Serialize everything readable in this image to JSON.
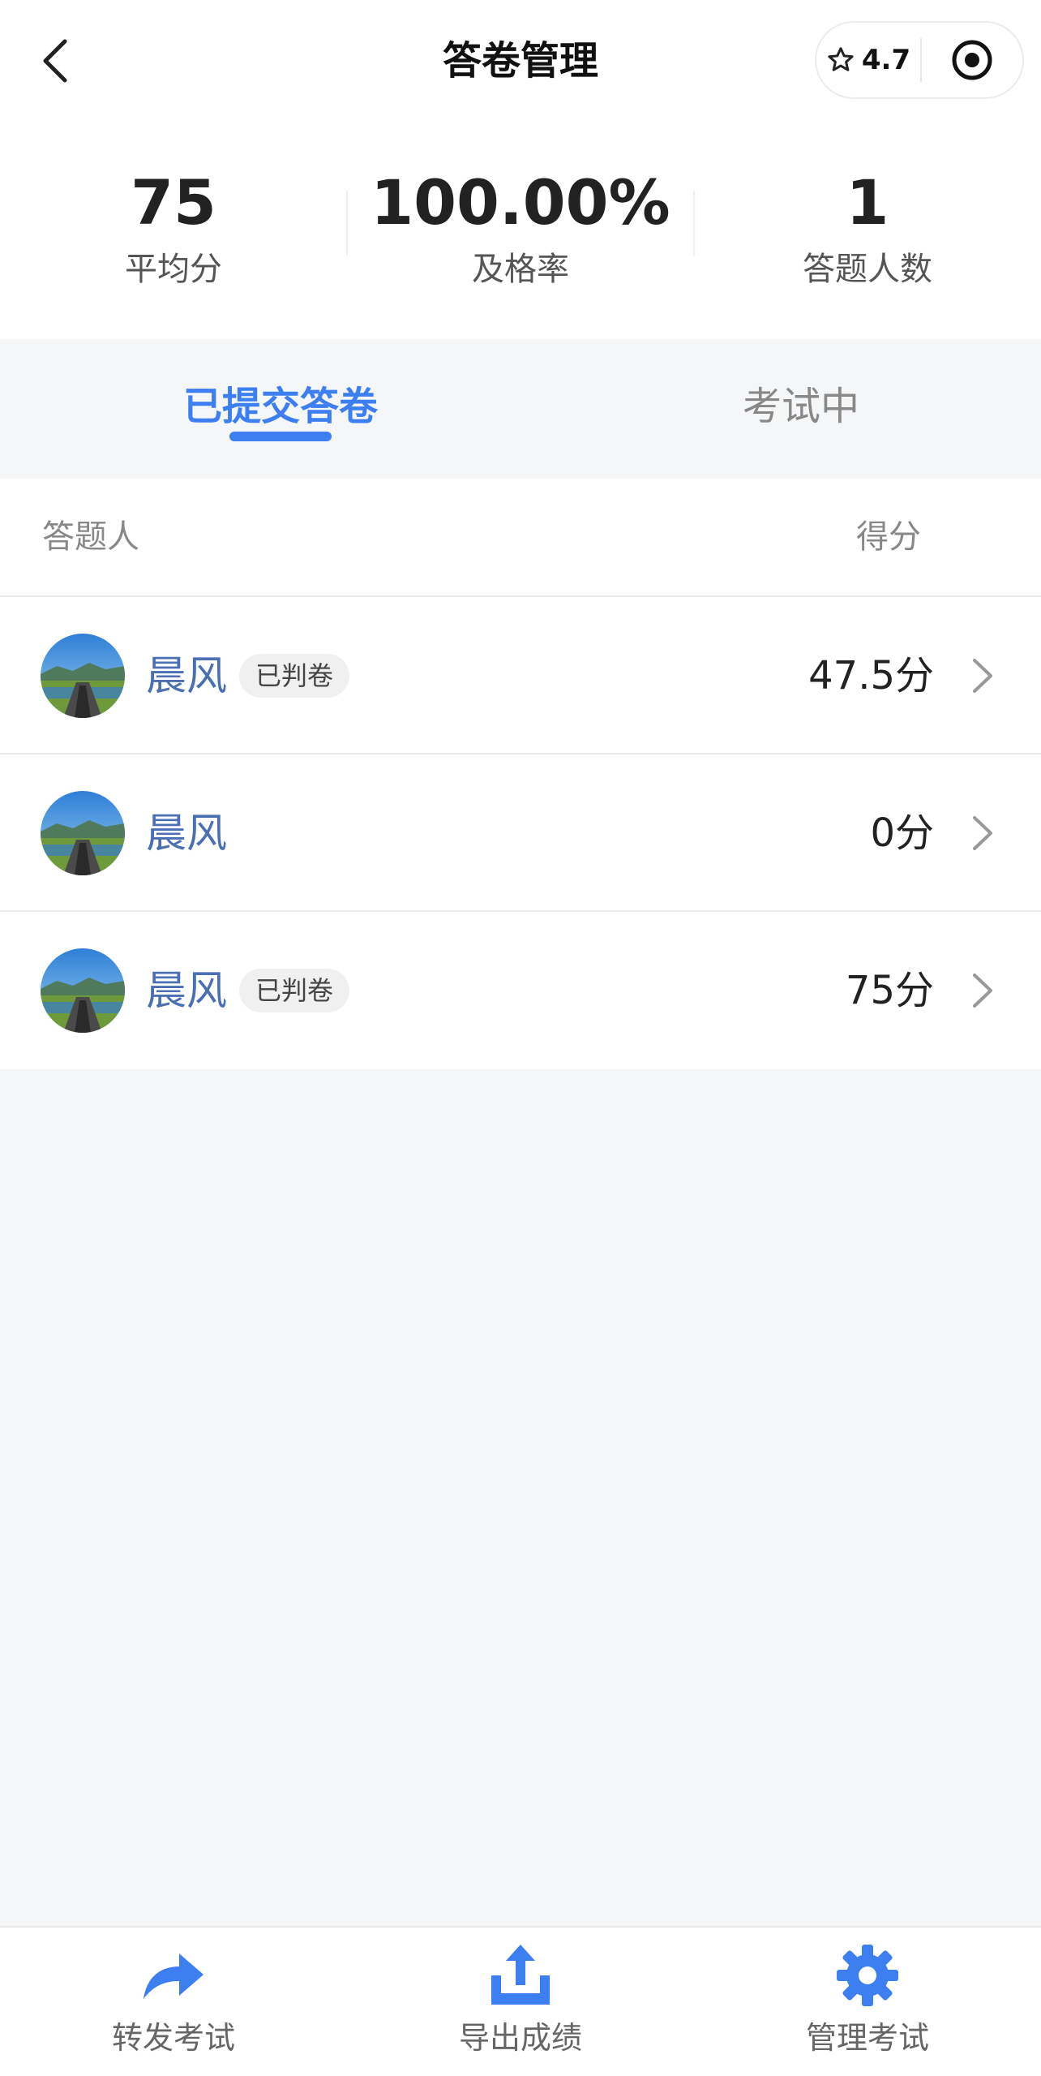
{
  "header": {
    "title": "答卷管理",
    "rating": "4.7"
  },
  "stats": [
    {
      "value": "75",
      "label": "平均分"
    },
    {
      "value": "100.00%",
      "label": "及格率"
    },
    {
      "value": "1",
      "label": "答题人数"
    }
  ],
  "tabs": [
    {
      "label": "已提交答卷",
      "active": true
    },
    {
      "label": "考试中",
      "active": false
    }
  ],
  "table": {
    "col_left": "答题人",
    "col_right": "得分",
    "rows": [
      {
        "name": "晨风",
        "badge": "已判卷",
        "score": "47.5分"
      },
      {
        "name": "晨风",
        "badge": "",
        "score": "0分"
      },
      {
        "name": "晨风",
        "badge": "已判卷",
        "score": "75分"
      }
    ]
  },
  "bottom": [
    {
      "label": "转发考试",
      "icon": "share-arrow-icon"
    },
    {
      "label": "导出成绩",
      "icon": "export-icon"
    },
    {
      "label": "管理考试",
      "icon": "gear-icon"
    }
  ],
  "colors": {
    "accent": "#3d7ff0",
    "name": "#4a6fb3"
  }
}
